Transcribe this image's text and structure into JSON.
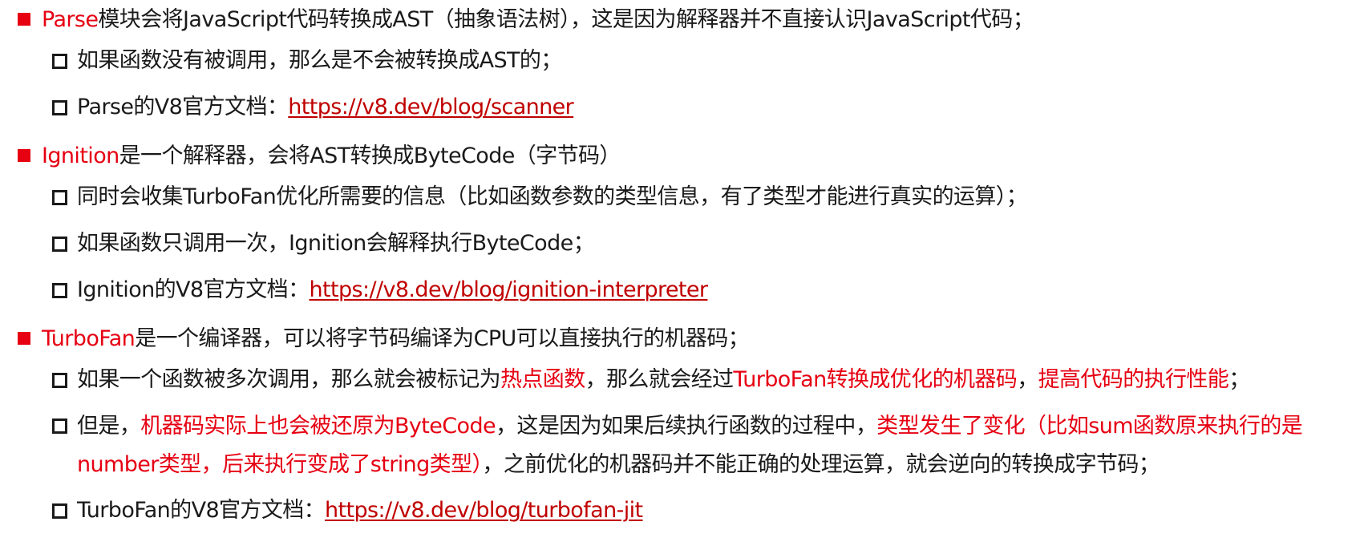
{
  "colors": {
    "accent": "#e60012",
    "link": "#c00000",
    "text": "#1a1a1a"
  },
  "icons": {
    "level1": "red-square-bullet-icon",
    "level2": "hollow-square-bullet-icon"
  },
  "parse": {
    "title_red": "Parse",
    "title_rest": "模块会将JavaScript代码转换成AST（抽象语法树），这是因为解释器并不直接认识JavaScript代码；",
    "item1": "如果函数没有被调用，那么是不会被转换成AST的；",
    "doc_label": "Parse的V8官方文档：",
    "doc_link": "https://v8.dev/blog/scanner"
  },
  "ignition": {
    "title_red": "Ignition",
    "title_rest": "是一个解释器，会将AST转换成ByteCode（字节码）",
    "item1": "同时会收集TurboFan优化所需要的信息（比如函数参数的类型信息，有了类型才能进行真实的运算）；",
    "item2": "如果函数只调用一次，Ignition会解释执行ByteCode；",
    "doc_label": "Ignition的V8官方文档：",
    "doc_link": "https://v8.dev/blog/ignition-interpreter"
  },
  "turbofan": {
    "title_red": "TurboFan",
    "title_rest": "是一个编译器，可以将字节码编译为CPU可以直接执行的机器码；",
    "item1": {
      "p1": "如果一个函数被多次调用，那么就会被标记为",
      "r1": "热点函数",
      "p2": "，那么就会经过",
      "r2": "TurboFan转换成优化的机器码",
      "p3": "，",
      "r3": "提高代码的执行性能",
      "p4": "；"
    },
    "item2": {
      "p1": "但是，",
      "r1": "机器码实际上也会被还原为ByteCode",
      "p2": "，这是因为如果后续执行函数的过程中，",
      "r2": "类型发生了变化（比如sum函数原来执行的是number类型，后来执行变成了string类型）",
      "p3": "，之前优化的机器码并不能正确的处理运算，就会逆向的转换成字节码；"
    },
    "doc_label": "TurboFan的V8官方文档：",
    "doc_link": "https://v8.dev/blog/turbofan-jit"
  }
}
